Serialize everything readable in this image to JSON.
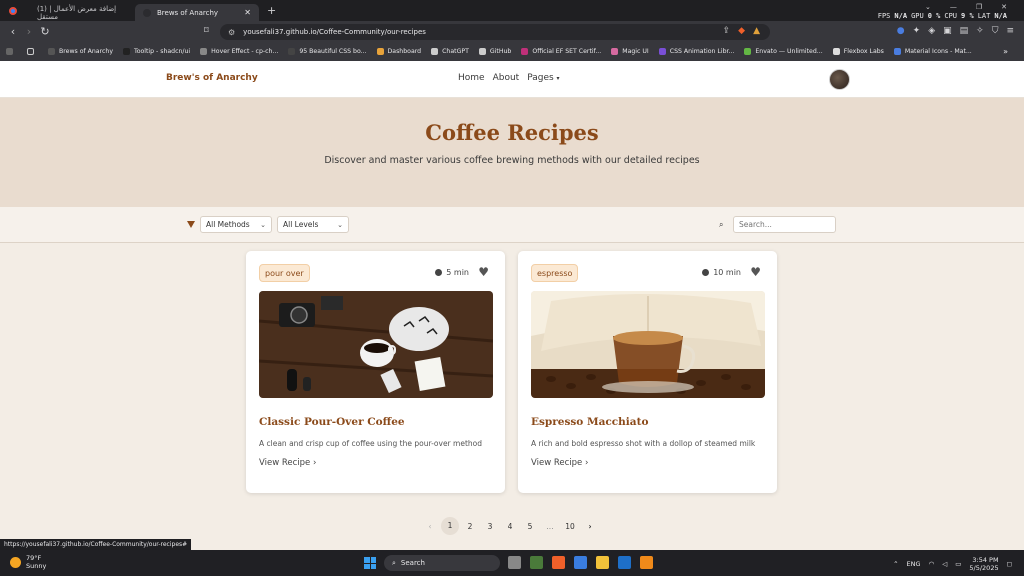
{
  "browser": {
    "tabs": [
      {
        "label": "(1) إضافة معرض الأعمال | مستقل",
        "active": false
      },
      {
        "label": "Brews of Anarchy",
        "active": true
      }
    ],
    "url": "yousefali37.github.io/Coffee-Community/our-recipes",
    "stats": {
      "fps_label": "FPS",
      "fps_value": "N/A",
      "gpu_label": "GPU",
      "gpu_value": "0 %",
      "cpu_label": "CPU",
      "cpu_value": "9 %",
      "lat_label": "LAT",
      "lat_value": "N/A"
    },
    "bookmarks": [
      {
        "label": "Brews of Anarchy",
        "color": "#555555"
      },
      {
        "label": "Tooltip - shadcn/ui",
        "color": "#222222"
      },
      {
        "label": "Hover Effect - cp-ch...",
        "color": "#888888"
      },
      {
        "label": "95 Beautiful CSS bo...",
        "color": "#444444"
      },
      {
        "label": "Dashboard",
        "color": "#e8a33a"
      },
      {
        "label": "ChatGPT",
        "color": "#cccccc"
      },
      {
        "label": "GitHub",
        "color": "#cccccc"
      },
      {
        "label": "Official EF SET Certif...",
        "color": "#c0307a"
      },
      {
        "label": "Magic UI",
        "color": "#d66aa0"
      },
      {
        "label": "CSS Animation Libr...",
        "color": "#7a4fd6"
      },
      {
        "label": "Envato — Unlimited...",
        "color": "#63b744"
      },
      {
        "label": "Flexbox Labs",
        "color": "#dddddd"
      },
      {
        "label": "Material Icons - Mat...",
        "color": "#4a7de0"
      }
    ],
    "status_url": "https://yousefali37.github.io/Coffee-Community/our-recipes#"
  },
  "site": {
    "brand": "Brew's of Anarchy",
    "nav": {
      "home": "Home",
      "about": "About",
      "pages": "Pages"
    },
    "hero": {
      "title": "Coffee Recipes",
      "subtitle": "Discover and master various coffee brewing methods with our detailed recipes"
    },
    "filters": {
      "methods": "All Methods",
      "levels": "All Levels",
      "search_placeholder": "Search..."
    },
    "cards": [
      {
        "tag": "pour over",
        "time": "5 min",
        "title": "Classic Pour-Over Coffee",
        "desc": "A clean and crisp cup of coffee using the pour-over method",
        "link": "View Recipe"
      },
      {
        "tag": "espresso",
        "time": "10 min",
        "title": "Espresso Macchiato",
        "desc": "A rich and bold espresso shot with a dollop of steamed milk",
        "link": "View Recipe"
      }
    ],
    "pagination": {
      "prev": "‹",
      "pages": [
        "1",
        "2",
        "3",
        "4",
        "5",
        "...",
        "10"
      ],
      "next": "›",
      "current": "1"
    }
  },
  "taskbar": {
    "weather_temp": "79°F",
    "weather_desc": "Sunny",
    "search": "Search",
    "lang": "ENG",
    "time": "3:54 PM",
    "date": "5/5/2025"
  },
  "colors": {
    "accent": "#8b4a1a",
    "hero_bg": "#e9dccf",
    "tag_bg": "#fbe9d4"
  }
}
